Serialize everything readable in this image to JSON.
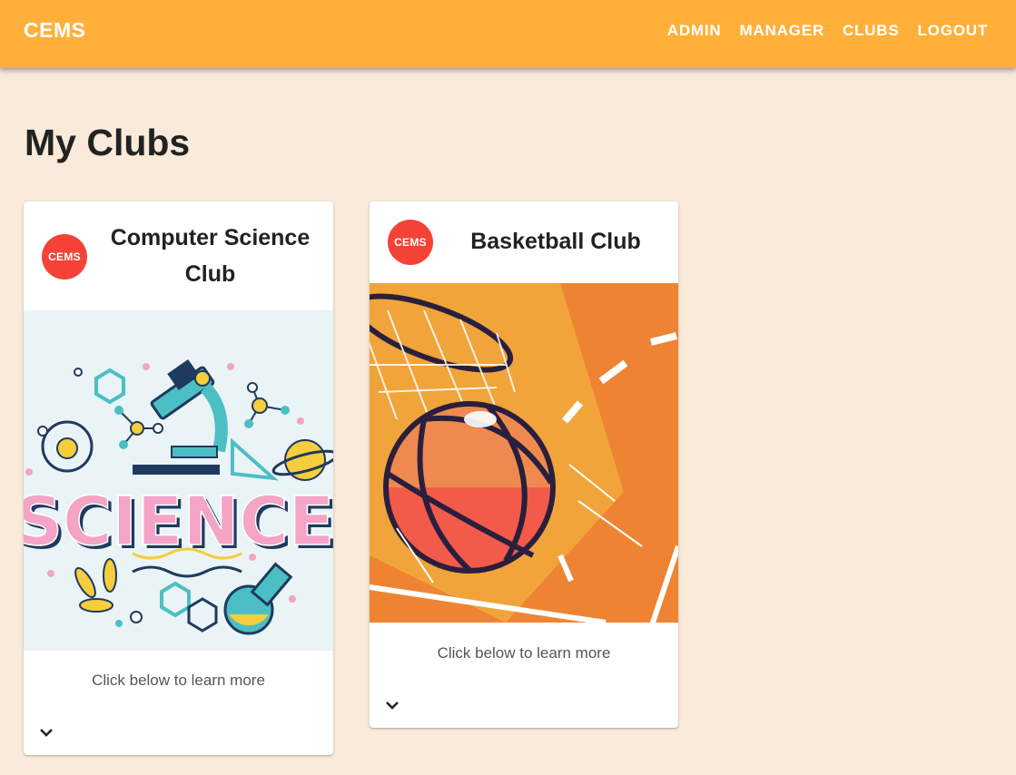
{
  "appbar": {
    "brand": "CEMS",
    "nav": [
      "ADMIN",
      "MANAGER",
      "CLUBS",
      "LOGOUT"
    ]
  },
  "page": {
    "title": "My Clubs"
  },
  "clubs": [
    {
      "avatar": "CEMS",
      "title_line1": "Computer Science",
      "title_line2": "Club",
      "image_word": "SCIENCE",
      "subtitle": "Click below to learn more"
    },
    {
      "avatar": "CEMS",
      "title_line1": "Basketball Club",
      "subtitle": "Click below to learn more"
    }
  ],
  "colors": {
    "appbar": "#ffb03b",
    "background": "#f9ead9",
    "avatar": "#f44336"
  }
}
